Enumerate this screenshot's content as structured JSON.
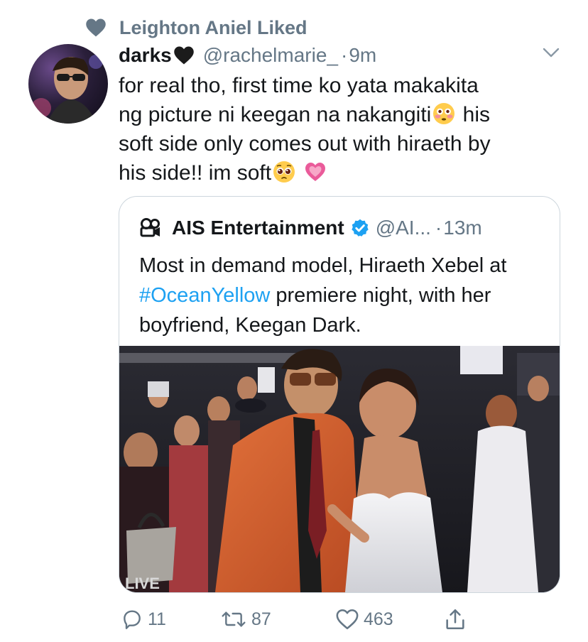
{
  "liked_by": {
    "text": "Leighton Aniel Liked"
  },
  "tweet": {
    "display_name": "darks",
    "handle": "@rachelmarie_",
    "dot": "·",
    "time": "9m",
    "text_line1": "for real tho, first time ko yata makakita",
    "text_line2a": "ng picture ni keegan na nakangiti",
    "text_line2b": " his",
    "text_line3": "soft side only comes out with hiraeth by",
    "text_line4": "his side!! im soft",
    "emoji_names": [
      "black-heart-icon",
      "flushed-face-icon",
      "pleading-face-icon",
      "pink-heart-icon"
    ]
  },
  "quote": {
    "display_name": "AIS Entertainment",
    "handle": "@AI...",
    "dot": "·",
    "time": "13m",
    "text_pre": "Most in demand model, Hiraeth Xebel at ",
    "hashtag": "#OceanYellow",
    "text_post": " premiere night, with her boyfriend, Keegan Dark.",
    "photo_sign": "LIVE"
  },
  "actions": {
    "reply_count": "11",
    "retweet_count": "87",
    "like_count": "463"
  },
  "colors": {
    "text": "#14171a",
    "secondary": "#657786",
    "link": "#1da1f2",
    "border": "#cdd6dd",
    "verified": "#1da1f2"
  }
}
